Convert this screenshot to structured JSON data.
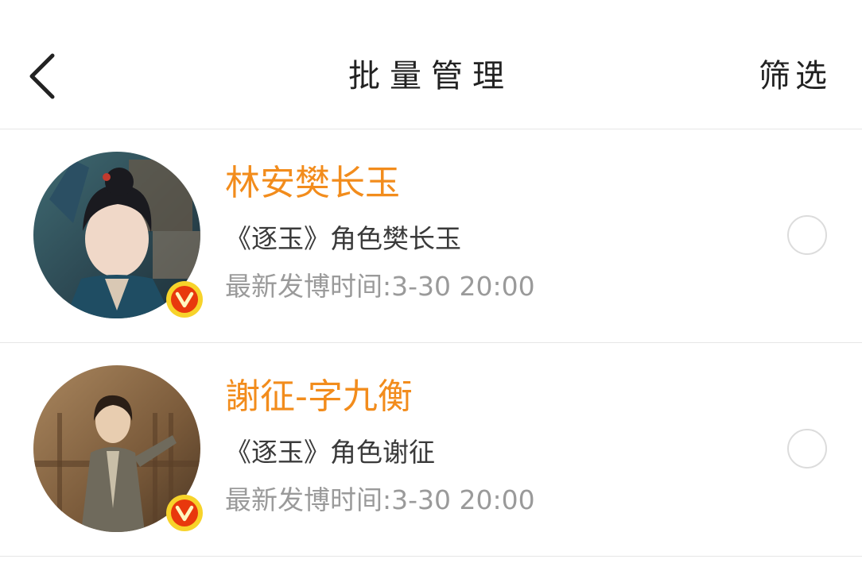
{
  "header": {
    "title": "批量管理",
    "filter_label": "筛选"
  },
  "accounts": [
    {
      "name": "林安樊长玉",
      "description": "《逐玉》角色樊长玉",
      "last_post": "最新发博时间:3-30 20:00",
      "verified": true,
      "selected": false
    },
    {
      "name": "謝征-字九衡",
      "description": "《逐玉》角色谢征",
      "last_post": "最新发博时间:3-30 20:00",
      "verified": true,
      "selected": false
    }
  ],
  "colors": {
    "name": "#f28c1c",
    "badge_outer": "#f7d32a",
    "badge_inner": "#e8380d",
    "divider": "#e6e6e6"
  },
  "icons": {
    "back": "chevron-left-icon",
    "verified": "verified-v-badge-icon",
    "select": "radio-circle-icon"
  }
}
